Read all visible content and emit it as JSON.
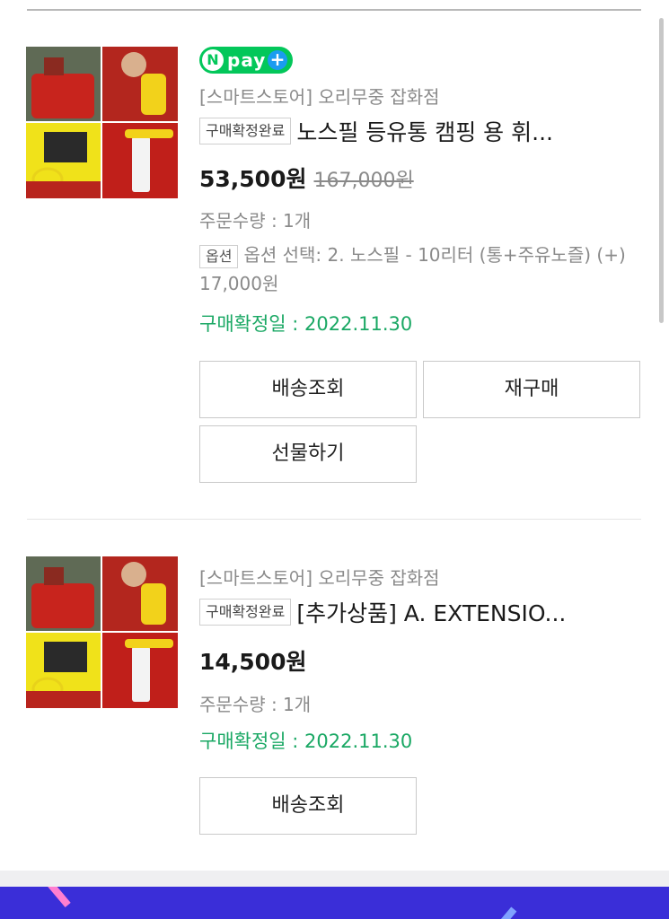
{
  "orders": [
    {
      "npay_badge": {
        "n": "N",
        "text": "pay",
        "plus": "+"
      },
      "store": "[스마트스토어] 오리무중 잡화점",
      "status": "구매확정완료",
      "title": "노스필 등유통 캠핑 용 휘...",
      "price": "53,500원",
      "original_price": "167,000원",
      "quantity": "주문수량 : 1개",
      "option_tag": "옵션",
      "option_text": "옵션 선택: 2. 노스필 - 10리터 (통+주유노즐) (+) 17,000원",
      "confirm_date": "구매확정일 : 2022.11.30",
      "buttons": {
        "delivery": "배송조회",
        "rebuy": "재구매",
        "gift": "선물하기"
      }
    },
    {
      "store": "[스마트스토어] 오리무중 잡화점",
      "status": "구매확정완료",
      "title": "[추가상품] A. EXTENSIO...",
      "price": "14,500원",
      "quantity": "주문수량 : 1개",
      "confirm_date": "구매확정일 : 2022.11.30",
      "buttons": {
        "delivery": "배송조회"
      }
    }
  ],
  "colors": {
    "npay_green": "#03c75a",
    "confirm_green": "#1aa864",
    "banner": "#3a2ed8"
  }
}
